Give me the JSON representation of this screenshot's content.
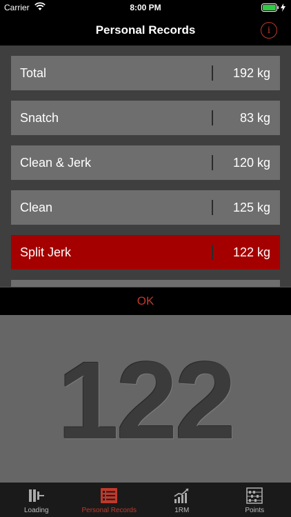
{
  "status": {
    "carrier": "Carrier",
    "time": "8:00 PM"
  },
  "nav": {
    "title": "Personal Records"
  },
  "records": [
    {
      "name": "Total",
      "value": "192 kg"
    },
    {
      "name": "Snatch",
      "value": "83 kg"
    },
    {
      "name": "Clean & Jerk",
      "value": "120 kg"
    },
    {
      "name": "Clean",
      "value": "125 kg"
    },
    {
      "name": "Split Jerk",
      "value": "122 kg"
    }
  ],
  "ok": {
    "label": "OK"
  },
  "picker": {
    "value": "122"
  },
  "tabs": [
    {
      "label": "Loading",
      "icon": "barbell-icon"
    },
    {
      "label": "Personal Records",
      "icon": "list-icon"
    },
    {
      "label": "1RM",
      "icon": "chart-icon"
    },
    {
      "label": "Points",
      "icon": "abacus-icon"
    }
  ],
  "colors": {
    "accent": "#c0392b",
    "selected_row": "#a50000",
    "battery": "#2ecc40"
  }
}
